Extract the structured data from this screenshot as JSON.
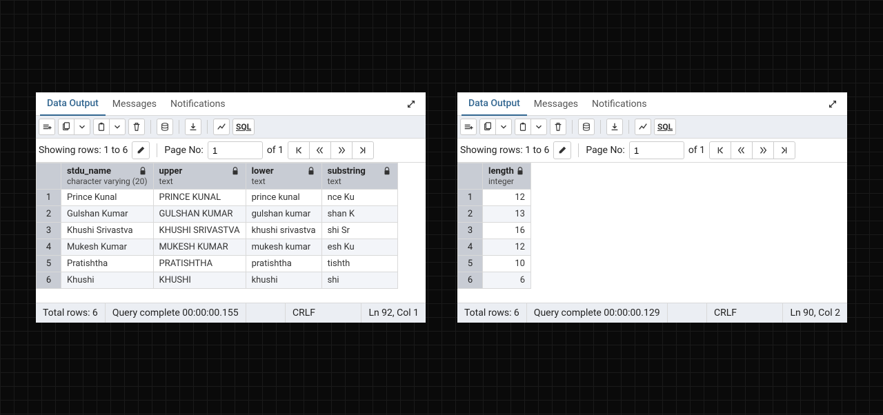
{
  "panels": [
    {
      "tabs": [
        "Data Output",
        "Messages",
        "Notifications"
      ],
      "activeTab": 0,
      "rowinfo": "Showing rows: 1 to 6",
      "pageLabel": "Page No:",
      "pageValue": "1",
      "pageOf": "of 1",
      "columns": [
        {
          "name": "stdu_name",
          "type": "character varying (20)",
          "lock": true
        },
        {
          "name": "upper",
          "type": "text",
          "lock": true
        },
        {
          "name": "lower",
          "type": "text",
          "lock": true
        },
        {
          "name": "substring",
          "type": "text",
          "lock": true
        }
      ],
      "rows": [
        [
          "Prince Kunal",
          "PRINCE KUNAL",
          "prince kunal",
          "nce Ku"
        ],
        [
          "Gulshan Kumar",
          "GULSHAN KUMAR",
          "gulshan kumar",
          "shan K"
        ],
        [
          "Khushi Srivastva",
          "KHUSHI SRIVASTVA",
          "khushi srivastva",
          "shi Sr"
        ],
        [
          "Mukesh Kumar",
          "MUKESH KUMAR",
          "mukesh kumar",
          "esh Ku"
        ],
        [
          "Pratishtha",
          "PRATISHTHA",
          "pratishtha",
          "tishth"
        ],
        [
          "Khushi",
          "KHUSHI",
          "khushi",
          "shi"
        ]
      ],
      "status": {
        "totalRows": "Total rows: 6",
        "query": "Query complete 00:00:00.155",
        "eol": "CRLF",
        "cursor": "Ln 92, Col 1"
      }
    },
    {
      "tabs": [
        "Data Output",
        "Messages",
        "Notifications"
      ],
      "activeTab": 0,
      "rowinfo": "Showing rows: 1 to 6",
      "pageLabel": "Page No:",
      "pageValue": "1",
      "pageOf": "of 1",
      "columns": [
        {
          "name": "length",
          "type": "integer",
          "lock": true,
          "numeric": true
        }
      ],
      "rows": [
        [
          "12"
        ],
        [
          "13"
        ],
        [
          "16"
        ],
        [
          "12"
        ],
        [
          "10"
        ],
        [
          "6"
        ]
      ],
      "status": {
        "totalRows": "Total rows: 6",
        "query": "Query complete 00:00:00.129",
        "eol": "CRLF",
        "cursor": "Ln 90, Col 2"
      }
    }
  ],
  "icons": {
    "sql": "SQL"
  }
}
